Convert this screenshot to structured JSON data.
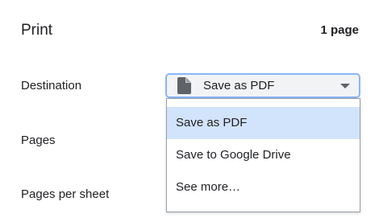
{
  "header": {
    "title": "Print",
    "page_count": "1 page"
  },
  "rows": {
    "destination_label": "Destination",
    "pages_label": "Pages",
    "pages_per_sheet_label": "Pages per sheet"
  },
  "destination": {
    "selected": "Save as PDF",
    "icon": "document-icon",
    "options": [
      {
        "label": "Save as PDF",
        "selected": true
      },
      {
        "label": "Save to Google Drive",
        "selected": false
      },
      {
        "label": "See more…",
        "selected": false
      }
    ]
  },
  "colors": {
    "focus_border": "#8ab4f8",
    "selected_option_bg": "#d2e3fc",
    "select_bg": "#f1f3f4",
    "text": "#202124"
  }
}
